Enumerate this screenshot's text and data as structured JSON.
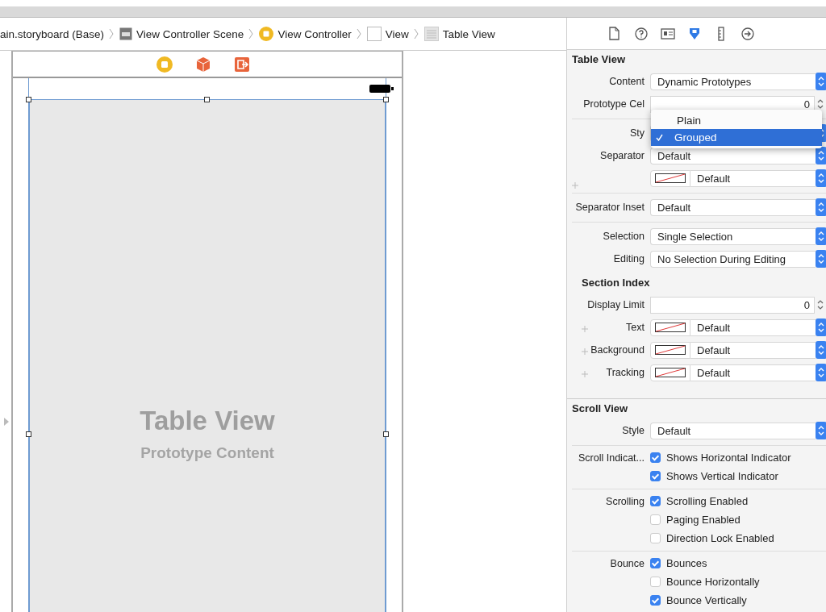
{
  "breadcrumb": [
    {
      "label": "ain.storyboard (Base)"
    },
    {
      "label": "View Controller Scene"
    },
    {
      "label": "View Controller"
    },
    {
      "label": "View"
    },
    {
      "label": "Table View"
    }
  ],
  "scene": {
    "table_view": {
      "title": "Table View",
      "subtitle": "Prototype Content"
    }
  },
  "inspector": {
    "tabs": [
      {
        "selected": false
      },
      {
        "selected": false
      },
      {
        "selected": false
      },
      {
        "selected": true
      },
      {
        "selected": false
      },
      {
        "selected": false
      }
    ],
    "sections": [
      {
        "title": "Table View",
        "kind": "section",
        "groups": [
          [
            {
              "kind": "popup",
              "label": "Content",
              "value": "Dynamic Prototypes"
            },
            {
              "kind": "stepper",
              "label": "Prototype Cel",
              "value": "0"
            }
          ],
          [
            {
              "kind": "popup",
              "label": "Sty"
            },
            {
              "kind": "popup",
              "label": "Separator",
              "value": "Default"
            },
            {
              "kind": "color",
              "value": "Default"
            }
          ],
          [
            {
              "kind": "popup",
              "label": "Separator Inset",
              "value": "Default"
            }
          ],
          [
            {
              "kind": "popup",
              "label": "Selection",
              "value": "Single Selection"
            },
            {
              "kind": "popup",
              "label": "Editing",
              "value": "No Selection During Editing"
            }
          ]
        ]
      },
      {
        "title": "Section Index",
        "kind": "subsection",
        "groups": [
          [
            {
              "kind": "stepper",
              "label": "Display Limit",
              "value": "0"
            },
            {
              "kind": "color",
              "label": "Text",
              "value": "Default"
            },
            {
              "kind": "color",
              "label": "Background",
              "value": "Default"
            },
            {
              "kind": "color",
              "label": "Tracking",
              "value": "Default"
            }
          ]
        ]
      },
      {
        "title": "Scroll View",
        "kind": "section",
        "groups": [
          [
            {
              "kind": "popup",
              "label": "Style",
              "value": "Default"
            }
          ],
          [
            {
              "kind": "checks",
              "label": "Scroll Indicat...",
              "items": [
                {
                  "label": "Shows Horizontal Indicator",
                  "checked": true
                },
                {
                  "label": "Shows Vertical Indicator",
                  "checked": true
                }
              ]
            }
          ],
          [
            {
              "kind": "checks",
              "label": "Scrolling",
              "items": [
                {
                  "label": "Scrolling Enabled",
                  "checked": true
                },
                {
                  "label": "Paging Enabled",
                  "checked": false
                },
                {
                  "label": "Direction Lock Enabled",
                  "checked": false
                }
              ]
            }
          ],
          [
            {
              "kind": "checks",
              "label": "Bounce",
              "items": [
                {
                  "label": "Bounces",
                  "checked": true
                },
                {
                  "label": "Bounce Horizontally",
                  "checked": false
                },
                {
                  "label": "Bounce Vertically",
                  "checked": true
                }
              ]
            }
          ]
        ]
      }
    ],
    "style_menu": [
      {
        "label": "Plain",
        "selected": false
      },
      {
        "label": "Grouped",
        "selected": true
      }
    ]
  }
}
